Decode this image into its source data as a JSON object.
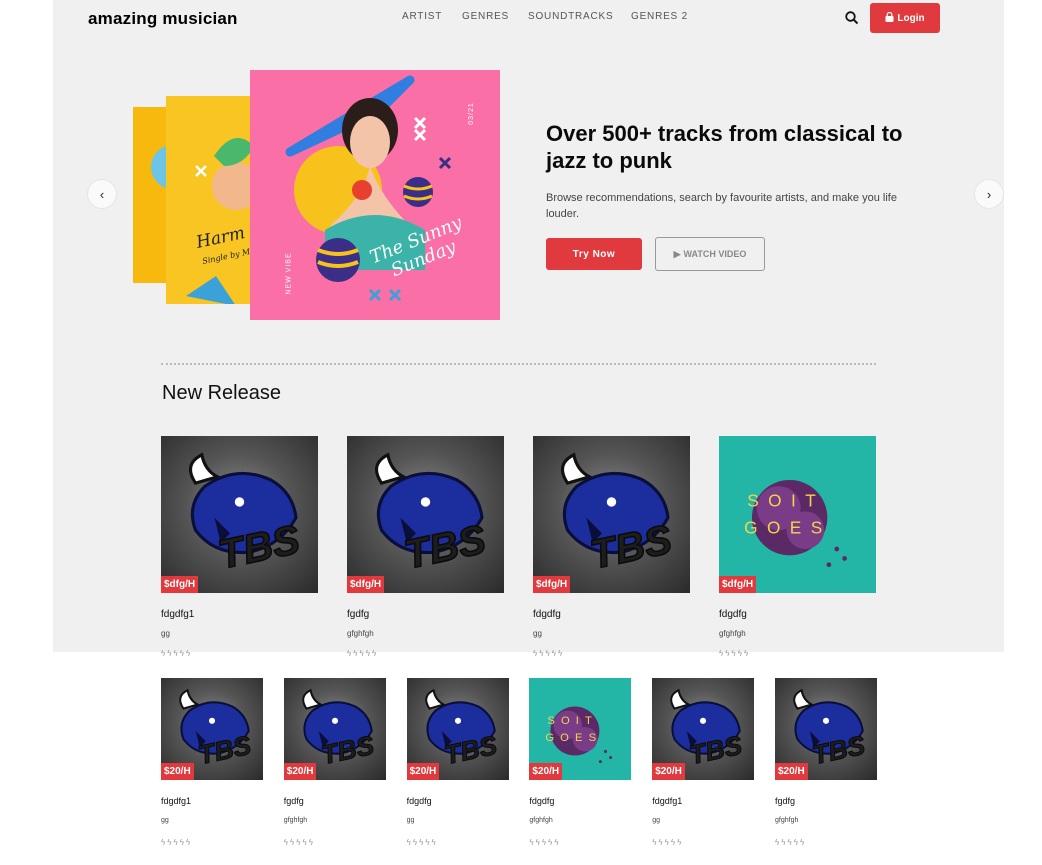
{
  "header": {
    "logo": "amazing musician",
    "nav": [
      "ARTIST",
      "GENRES",
      "SOUNDTRACKS",
      "GENRES 2"
    ],
    "login_label": "Login"
  },
  "hero": {
    "title": "Over 500+ tracks from classical to jazz to punk",
    "description": "Browse recommendations, search by favourite artists, and make you life louder.",
    "try_label": "Try Now",
    "watch_label": "WATCH VIDEO",
    "cover_front_title": "The Sunny Sunday",
    "cover_front_date": "03/21",
    "cover_front_tag": "NEW VIBE",
    "cover_back_title": "Harm",
    "cover_back_sub": "Single by M"
  },
  "new_release": {
    "title": "New Release",
    "large": [
      {
        "price": "$dfg/H",
        "title": "fdgdfg1",
        "sub": "gg",
        "art": "TBS"
      },
      {
        "price": "$dfg/H",
        "title": "fgdfg",
        "sub": "gfghfgh",
        "art": "TBS"
      },
      {
        "price": "$dfg/H",
        "title": "fdgdfg",
        "sub": "gg",
        "art": "TBS"
      },
      {
        "price": "$dfg/H",
        "title": "fdgdfg",
        "sub": "gfghfgh",
        "art": "SOIT GOES"
      }
    ],
    "small": [
      {
        "price": "$20/H",
        "title": "fdgdfg1",
        "sub": "gg",
        "art": "TBS"
      },
      {
        "price": "$20/H",
        "title": "fgdfg",
        "sub": "gfghfgh",
        "art": "TBS"
      },
      {
        "price": "$20/H",
        "title": "fdgdfg",
        "sub": "gg",
        "art": "TBS"
      },
      {
        "price": "$20/H",
        "title": "fdgdfg",
        "sub": "gfghfgh",
        "art": "SOIT GOES"
      },
      {
        "price": "$20/H",
        "title": "fdgdfg1",
        "sub": "gg",
        "art": "TBS"
      },
      {
        "price": "$20/H",
        "title": "fgdfg",
        "sub": "gfghfgh",
        "art": "TBS"
      }
    ]
  },
  "colors": {
    "accent": "#e0393e",
    "background": "#f0f0f0"
  },
  "icons": {
    "search": "search-icon",
    "lock": "lock-icon",
    "play": "play-icon",
    "prev": "chevron-left-icon",
    "next": "chevron-right-icon",
    "rating": "bolt-icon"
  }
}
